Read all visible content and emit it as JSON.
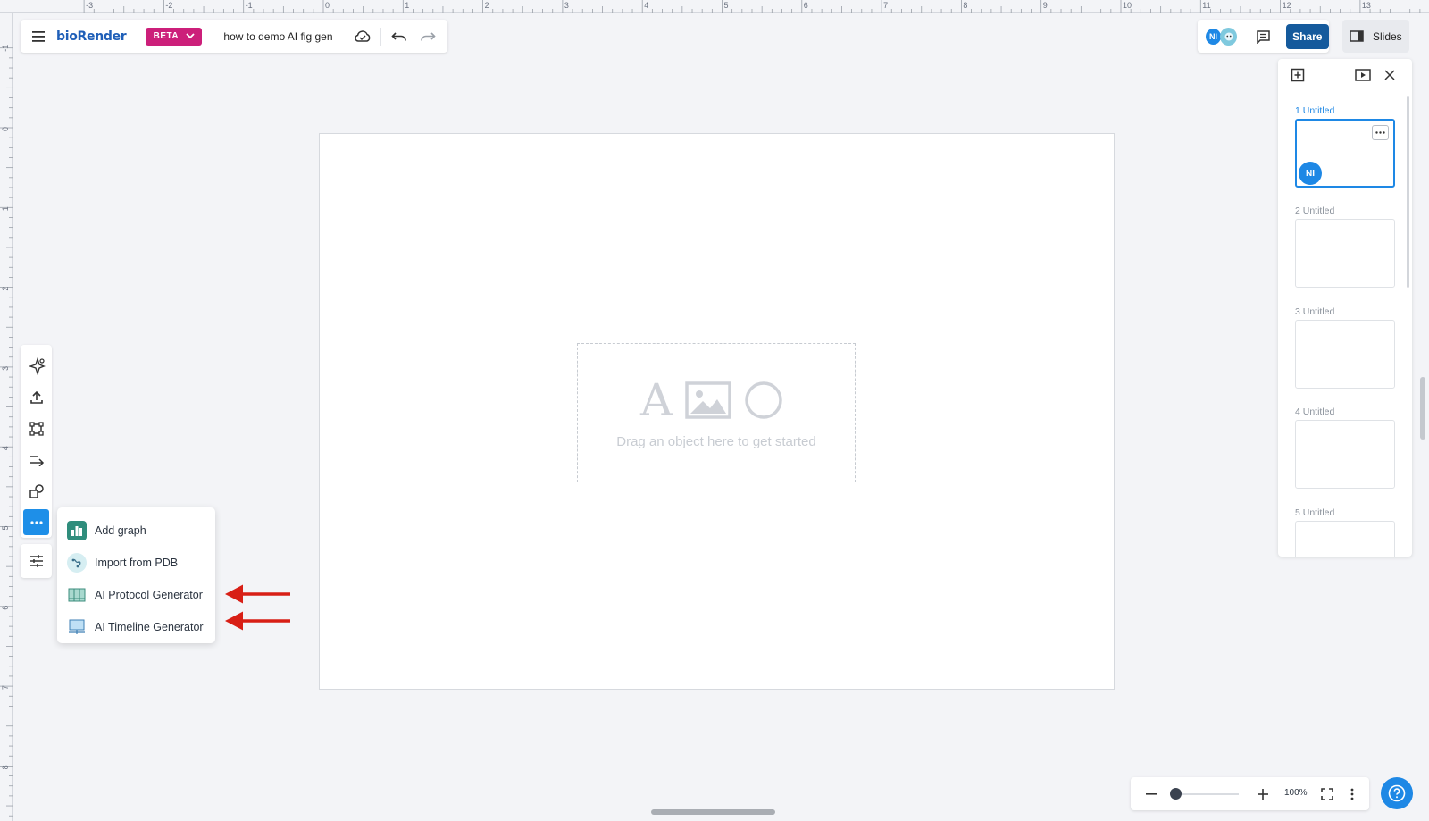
{
  "ruler": {
    "top_labels": [
      "-3",
      "-2",
      "-1",
      "0",
      "1",
      "2",
      "3",
      "4",
      "5",
      "6",
      "7",
      "8",
      "9",
      "10",
      "11",
      "12",
      "13"
    ],
    "left_labels": [
      "-1",
      "0",
      "1",
      "2",
      "3",
      "4",
      "5",
      "6",
      "7",
      "8"
    ]
  },
  "header": {
    "logo": "bioRender",
    "beta_label": "BETA",
    "doc_title": "how to demo AI fig gen",
    "icons": [
      "menu-icon",
      "cloud-saved-icon",
      "undo-icon",
      "redo-icon"
    ]
  },
  "collab": {
    "user_initials": "NI",
    "share_label": "Share",
    "slides_label": "Slides"
  },
  "canvas": {
    "placeholder_text": "Drag an object here to get started",
    "placeholder_letter": "A"
  },
  "tools": {
    "icons": [
      "ai-sparkle-icon",
      "upload-icon",
      "frame-icon",
      "arrow-line-icon",
      "shapes-icon",
      "more-icon",
      "settings-sliders-icon"
    ],
    "active": "more-icon"
  },
  "more_menu": {
    "items": [
      {
        "label": "Add graph",
        "icon": "bar-chart-icon"
      },
      {
        "label": "Import from PDB",
        "icon": "molecule-icon"
      },
      {
        "label": "AI Protocol Generator",
        "icon": "protocol-table-icon"
      },
      {
        "label": "AI Timeline Generator",
        "icon": "timeline-icon"
      }
    ]
  },
  "slides_panel": {
    "slides": [
      {
        "label": "1 Untitled",
        "active": true,
        "avatar": "NI"
      },
      {
        "label": "2 Untitled",
        "active": false
      },
      {
        "label": "3 Untitled",
        "active": false
      },
      {
        "label": "4 Untitled",
        "active": false
      },
      {
        "label": "5 Untitled",
        "active": false
      }
    ]
  },
  "zoom": {
    "level_label": "100%",
    "slider_fraction": 0.05
  },
  "colors": {
    "accent": "#1e88e5",
    "share": "#155a9c",
    "beta": "#cc1f7a",
    "annotation_arrow": "#d81f16"
  }
}
